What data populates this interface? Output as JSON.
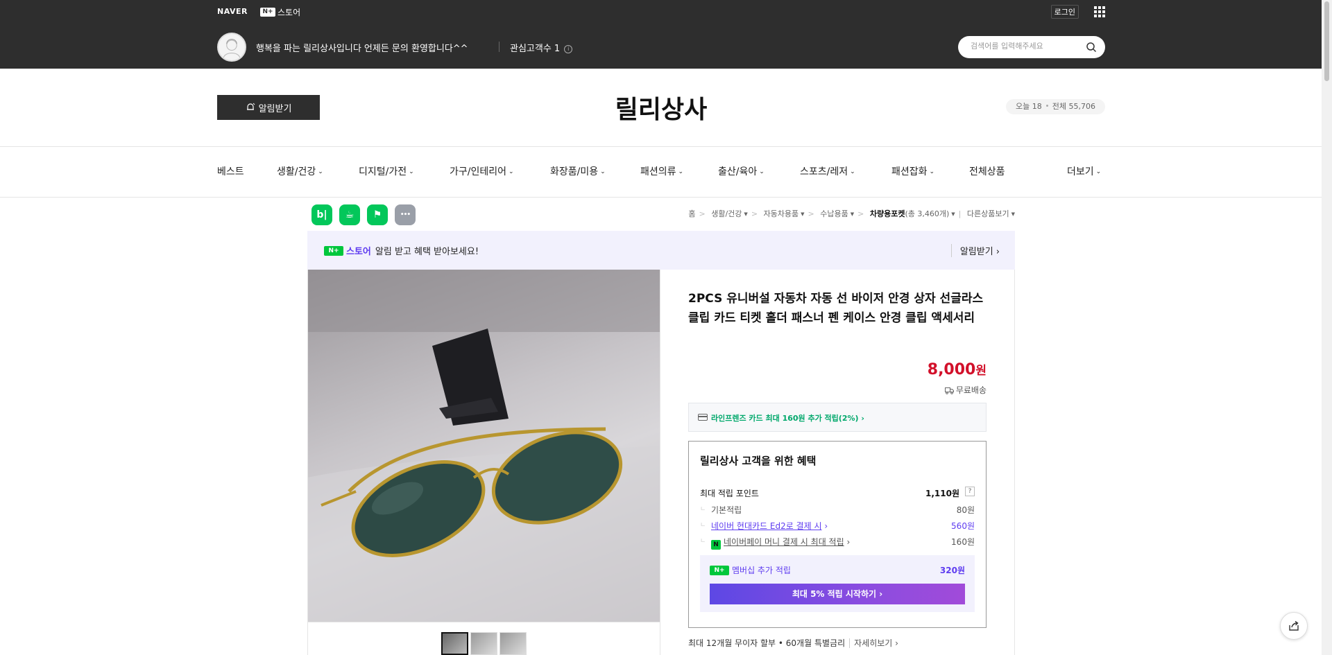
{
  "header": {
    "naver_logo": "NAVER",
    "nplus_badge": "N+",
    "nplus_label": "스토어",
    "login": "로그인",
    "store_description": "행복을 파는 릴리상사입니다 언제든 문의 환영합니다^^",
    "interest_customers": "관심고객수 1",
    "search_placeholder": "검색어를 입력해주세요"
  },
  "banner": {
    "notify_button": "알림받기",
    "store_name": "릴리상사",
    "today": "오늘 18",
    "total": "전체 55,706"
  },
  "nav": [
    {
      "label": "베스트",
      "chev": ""
    },
    {
      "label": "생활/건강",
      "chev": "⌄"
    },
    {
      "label": "디지털/가전",
      "chev": "⌄"
    },
    {
      "label": "가구/인테리어",
      "chev": "⌄"
    },
    {
      "label": "화장품/미용",
      "chev": "⌄"
    },
    {
      "label": "패션의류",
      "chev": "⌄"
    },
    {
      "label": "출산/육아",
      "chev": "⌄"
    },
    {
      "label": "스포츠/레저",
      "chev": "⌄"
    },
    {
      "label": "패션잡화",
      "chev": "⌄"
    },
    {
      "label": "전체상품",
      "chev": ""
    },
    {
      "label": "더보기",
      "chev": "⌄"
    }
  ],
  "share_icons": [
    {
      "name": "blog-share-icon",
      "glyph": "b|",
      "color": "#03c75a"
    },
    {
      "name": "cafe-share-icon",
      "glyph": "☕",
      "color": "#03c75a"
    },
    {
      "name": "bookmark-share-icon",
      "glyph": "⚑",
      "color": "#03c75a"
    },
    {
      "name": "more-share-icon",
      "glyph": "•••",
      "color": "#9a9fa8"
    }
  ],
  "breadcrumb": {
    "home": "홈",
    "c1": "생활/건강",
    "c2": "자동차용품",
    "c3": "수납용품",
    "c4": "차량용포켓",
    "c4_count": "(총 3,460개)",
    "other": "다른상품보기"
  },
  "promo": {
    "badge": "N+",
    "store": "스토어",
    "text": "알림 받고 혜택 받아보세요!",
    "action": "알림받기 ›"
  },
  "product": {
    "title": "2PCS 유니버설 자동차 자동 선 바이저 안경 상자 선글라스 클립 카드 티켓 홀더 패스너 펜 케이스 안경 클립 액세서리",
    "price": "8,000",
    "price_unit": "원",
    "shipping": "무료배송",
    "card_promo": "라인프렌즈 카드 최대 160원 추가 적립(2%) ›",
    "installment": "최대 12개월 무이자 할부 • 60개월 특별금리",
    "installment_more": "자세히보기 ›"
  },
  "benefits": {
    "title": "릴리상사 고객을 위한 혜택",
    "max_points_label": "최대 적립 포인트",
    "max_points_value": "1,110원",
    "qmark": "?",
    "basic_label": "기본적립",
    "basic_value": "80원",
    "hyundai_label": "네이버 현대카드 Ed2로 결제 시",
    "hyundai_value": "560원",
    "npay_badge": "N",
    "npay_label": "네이버페이 머니 결제 시 최대 적립",
    "npay_value": "160원",
    "member_badge": "N+",
    "member_label": "멤버십 추가 적립",
    "member_value": "320원",
    "member_button": "최대 5% 적립 시작하기 ›"
  }
}
